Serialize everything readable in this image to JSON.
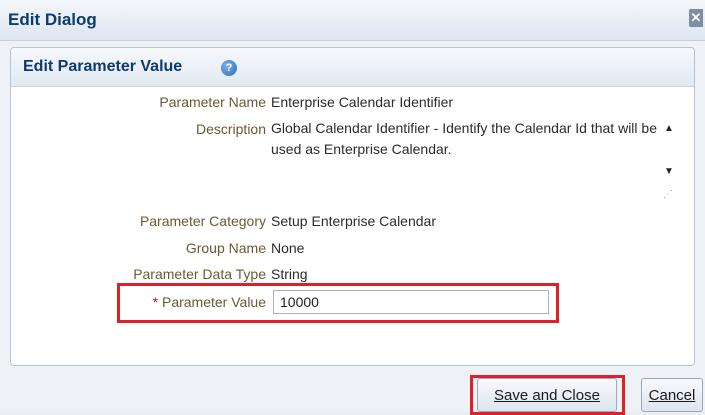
{
  "dialog": {
    "title": "Edit Dialog",
    "close_glyph": "✕",
    "close_icon": "close-icon"
  },
  "panel": {
    "title": "Edit Parameter Value",
    "help_glyph": "?",
    "help_icon": "help-icon"
  },
  "fields": {
    "parameter_name": {
      "label": "Parameter Name",
      "value": "Enterprise Calendar Identifier"
    },
    "description": {
      "label": "Description",
      "value": "Global Calendar Identifier - Identify the Calendar Id that will be used as Enterprise Calendar."
    },
    "parameter_category": {
      "label": "Parameter Category",
      "value": "Setup Enterprise Calendar"
    },
    "group_name": {
      "label": "Group Name",
      "value": "None"
    },
    "parameter_data_type": {
      "label": "Parameter Data Type",
      "value": "String"
    },
    "parameter_value": {
      "required_marker": "*",
      "label": "Parameter Value",
      "value": "10000"
    }
  },
  "scroll": {
    "up_glyph": "▲",
    "down_glyph": "▼",
    "grip_glyph": "⋰"
  },
  "buttons": {
    "save_and_close": "Save and Close",
    "cancel": "Cancel"
  },
  "colors": {
    "highlight": "#e01f2a",
    "title_text": "#0d3b6e",
    "label_text": "#6b5a31"
  }
}
